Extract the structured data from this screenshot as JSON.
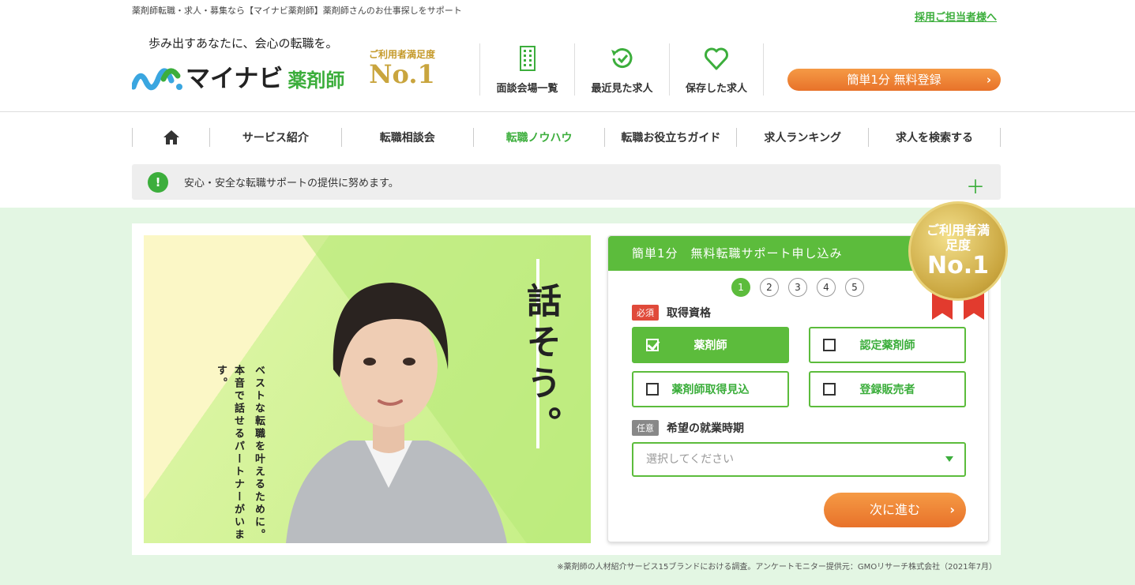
{
  "header": {
    "tagline": "薬剤師転職・求人・募集なら【マイナビ薬剤師】薬剤師さんのお仕事探しをサポート",
    "recruit_link": "採用ご担当者様へ",
    "slogan": "歩み出すあなたに、会心の転職を。",
    "logo_text": "マイナビ",
    "logo_sub": "薬剤師",
    "sat_label": "ご利用者満足度",
    "sat_rank": "No.1",
    "links": [
      {
        "label": "面談会場一覧",
        "icon": "building-icon"
      },
      {
        "label": "最近見た求人",
        "icon": "history-icon"
      },
      {
        "label": "保存した求人",
        "icon": "heart-icon"
      }
    ],
    "register_button": "簡単1分 無料登録"
  },
  "nav": {
    "items": [
      "サービス紹介",
      "転職相談会",
      "転職ノウハウ",
      "転職お役立ちガイド",
      "求人ランキング",
      "求人を検索する"
    ],
    "active": "転職ノウハウ"
  },
  "notice": {
    "text": "安心・安全な転職サポートの提供に努めます。",
    "icon": "!",
    "plus": "＋"
  },
  "hero": {
    "catch_main": "話そう。",
    "catch_sub1": "ベストな転職を叶えるために。",
    "catch_sub2": "本音で話せるパートナーがいます。"
  },
  "form": {
    "title": "簡単1分　無料転職サポート申し込み",
    "steps": [
      "1",
      "2",
      "3",
      "4",
      "5"
    ],
    "current_step": 1,
    "qualification": {
      "tag": "必須",
      "label": "取得資格",
      "options": [
        {
          "label": "薬剤師",
          "checked": true
        },
        {
          "label": "認定薬剤師",
          "checked": false
        },
        {
          "label": "薬剤師取得見込",
          "checked": false
        },
        {
          "label": "登録販売者",
          "checked": false
        }
      ]
    },
    "timing": {
      "tag": "任意",
      "label": "希望の就業時期",
      "placeholder": "選択してください"
    },
    "next_button": "次に進む"
  },
  "medal": {
    "line1": "ご利用者満足度",
    "line2": "No.1"
  },
  "footnote": "※薬剤師の人材紹介サービス15ブランドにおける調査。アンケートモニター提供元：GMOリサーチ株式会社（2021年7月）",
  "colors": {
    "brand_green": "#3cae3c",
    "form_green": "#5cbc3c",
    "orange": "#e8722a",
    "gold": "#c9a53e",
    "hero_bg": "#e3f6e3"
  }
}
